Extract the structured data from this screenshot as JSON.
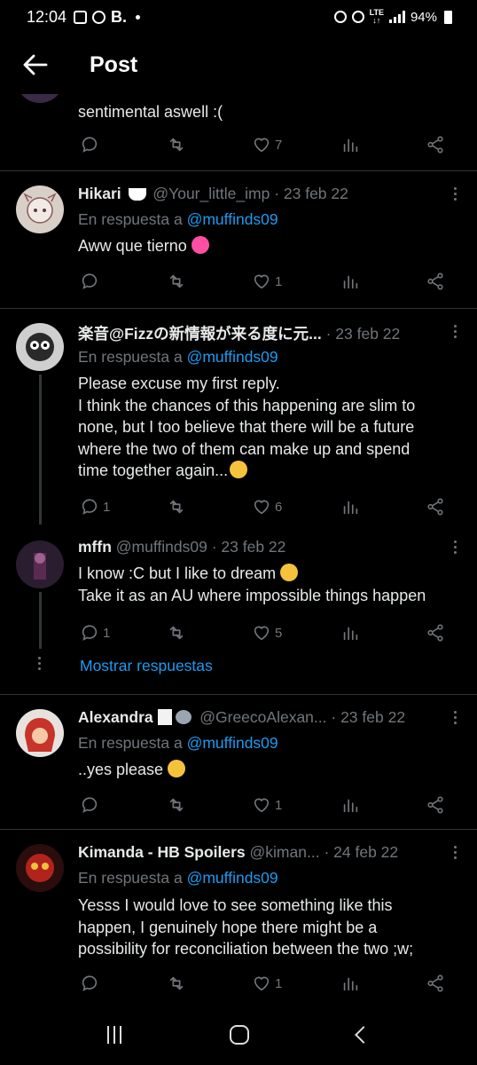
{
  "status_bar": {
    "time": "12:04",
    "battery": "94%",
    "network": "LTE"
  },
  "header": {
    "title": "Post"
  },
  "top_fragment": {
    "text": "sentimental aswell :(",
    "likes": "7"
  },
  "tweets": [
    {
      "name": "Hikari",
      "handle": "@Your_little_imp",
      "date": "· 23 feb 22",
      "reply_prefix": "En respuesta a",
      "reply_mention": "@muffinds09",
      "text": "Aww que tierno",
      "replies": "",
      "likes": "1"
    },
    {
      "name": "楽音@Fizzの新情報が来る度に元...",
      "handle": "",
      "date": "· 23 feb 22",
      "reply_prefix": "En respuesta a",
      "reply_mention": "@muffinds09",
      "text_lines": [
        "Please excuse my first reply.",
        "I think the chances of this happening are slim to",
        "none, but I too believe that there will be a future",
        "where the two of them can make up and spend",
        "time together again..."
      ],
      "replies": "1",
      "likes": "6"
    },
    {
      "name": "mffn",
      "handle": "@muffinds09",
      "date": "· 23 feb 22",
      "text_lines": [
        "I know :C but I like to dream",
        "Take it as an AU where impossible things happen"
      ],
      "replies": "1",
      "likes": "5"
    },
    {
      "name": "Alexandra",
      "handle": "@GreecoAlexan...",
      "date": "· 23 feb 22",
      "reply_prefix": "En respuesta a",
      "reply_mention": "@muffinds09",
      "text": "..yes please",
      "replies": "",
      "likes": "1"
    },
    {
      "name": "Kimanda - HB Spoilers",
      "handle": "@kiman...",
      "date": "· 24 feb 22",
      "reply_prefix": "En respuesta a",
      "reply_mention": "@muffinds09",
      "text_lines": [
        "Yesss I would love to see something like this",
        "happen, I genuinely hope there might be a",
        "possibility for reconciliation between the two ;w;"
      ],
      "replies": "",
      "likes": "1"
    }
  ],
  "show_replies_label": "Mostrar respuestas",
  "colors": {
    "background": "#000000",
    "accent": "#1d9bf0",
    "muted": "#71767b",
    "divider": "#2f3336"
  }
}
